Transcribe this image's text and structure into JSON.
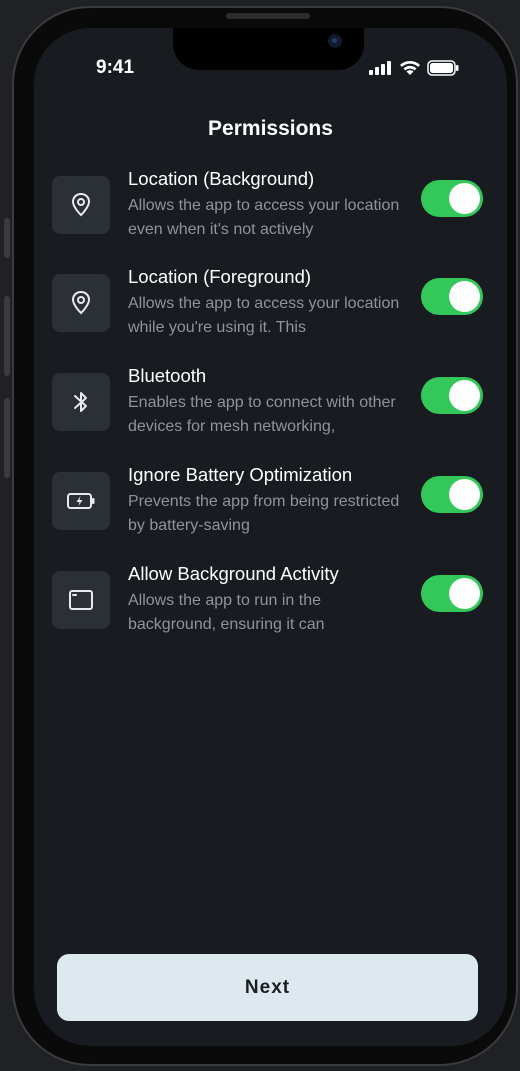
{
  "status_bar": {
    "time": "9:41",
    "icons": [
      "signal-icon",
      "wifi-icon",
      "battery-icon"
    ]
  },
  "header": {
    "title": "Permissions"
  },
  "permissions": [
    {
      "icon": "location-pin-icon",
      "title": "Location (Background)",
      "description": "Allows the app to access your location even when it's not actively",
      "enabled": true
    },
    {
      "icon": "location-pin-icon",
      "title": "Location (Foreground)",
      "description": "Allows the app to access your location while you're using it. This",
      "enabled": true
    },
    {
      "icon": "bluetooth-icon",
      "title": "Bluetooth",
      "description": "Enables the app to connect with other devices for mesh networking,",
      "enabled": true
    },
    {
      "icon": "battery-charging-icon",
      "title": "Ignore Battery Optimization",
      "description": "Prevents the app from being restricted by battery-saving",
      "enabled": true
    },
    {
      "icon": "window-icon",
      "title": "Allow Background Activity",
      "description": "Allows the app to run in the background, ensuring it can",
      "enabled": true
    }
  ],
  "footer": {
    "next_label": "Next"
  },
  "colors": {
    "background": "#181c21",
    "toggle_on": "#34c759",
    "button": "#dde8ef"
  }
}
